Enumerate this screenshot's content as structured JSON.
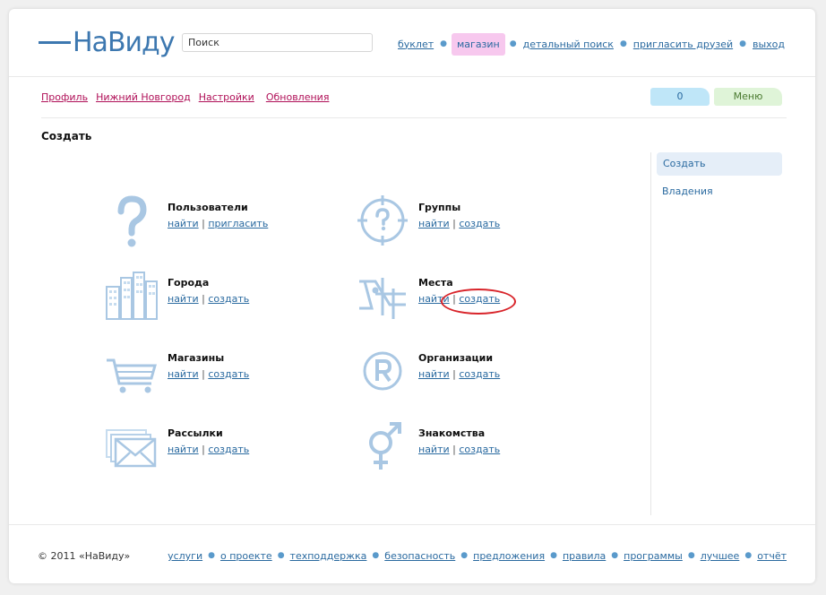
{
  "logo": {
    "text": "НаВиду"
  },
  "search": {
    "placeholder": "Поиск"
  },
  "topnav": [
    "буклет",
    "магазин",
    "детальный поиск",
    "пригласить друзей",
    "выход"
  ],
  "subnav": [
    "Профиль",
    "Нижний Новгород",
    "Настройки",
    "Обновления"
  ],
  "counter": "0",
  "menu_label": "Меню",
  "page_title": "Создать",
  "sidebar": {
    "items": [
      "Создать",
      "Владения"
    ]
  },
  "grid": [
    {
      "title": "Пользователи",
      "a1": "найти",
      "a2": "пригласить",
      "icon": "question-icon"
    },
    {
      "title": "Группы",
      "a1": "найти",
      "a2": "создать",
      "icon": "target-question-icon"
    },
    {
      "title": "Города",
      "a1": "найти",
      "a2": "создать",
      "icon": "buildings-icon"
    },
    {
      "title": "Места",
      "a1": "найти",
      "a2": "создать",
      "icon": "map-icon"
    },
    {
      "title": "Магазины",
      "a1": "найти",
      "a2": "создать",
      "icon": "cart-icon"
    },
    {
      "title": "Организации",
      "a1": "найти",
      "a2": "создать",
      "icon": "registered-icon"
    },
    {
      "title": "Рассылки",
      "a1": "найти",
      "a2": "создать",
      "icon": "envelope-icon"
    },
    {
      "title": "Знакомства",
      "a1": "найти",
      "a2": "создать",
      "icon": "gender-icon"
    }
  ],
  "footer": {
    "copyright": "© 2011 «НаВиду»",
    "links": [
      "услуги",
      "о проекте",
      "техподдержка",
      "безопасность",
      "предложения",
      "правила",
      "программы",
      "лучшее",
      "отчёт"
    ]
  },
  "colors": {
    "accent": "#3d78b0",
    "icon": "#a9c7e3",
    "pink": "#f7c8ee",
    "highlight": "#d8242a"
  }
}
